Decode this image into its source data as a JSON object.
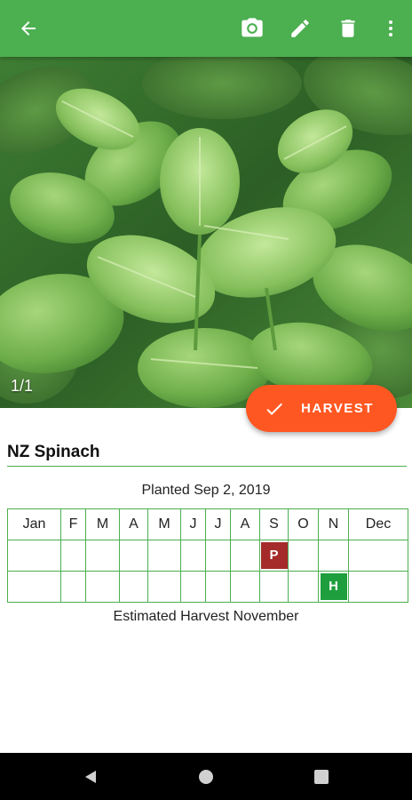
{
  "app": {
    "icons": {
      "back": "arrow-left-icon",
      "camera": "camera-icon",
      "edit": "pencil-icon",
      "delete": "trash-icon",
      "more": "more-vert-icon"
    },
    "colors": {
      "primary": "#4caf50",
      "accent": "#ff5722",
      "planted": "#a52a2a",
      "harvest": "#1e9e3c"
    }
  },
  "photo": {
    "counter": "1/1"
  },
  "fab": {
    "label": "HARVEST",
    "icon": "check-icon"
  },
  "plant": {
    "name": "NZ Spinach",
    "planted": "Planted Sep 2, 2019",
    "estimate": "Estimated Harvest November"
  },
  "calendar": {
    "months": [
      "Jan",
      "F",
      "M",
      "A",
      "M",
      "J",
      "J",
      "A",
      "S",
      "O",
      "N",
      "Dec"
    ],
    "planted_marker": "P",
    "harvest_marker": "H",
    "planted_month": "S",
    "harvest_month": "N"
  }
}
